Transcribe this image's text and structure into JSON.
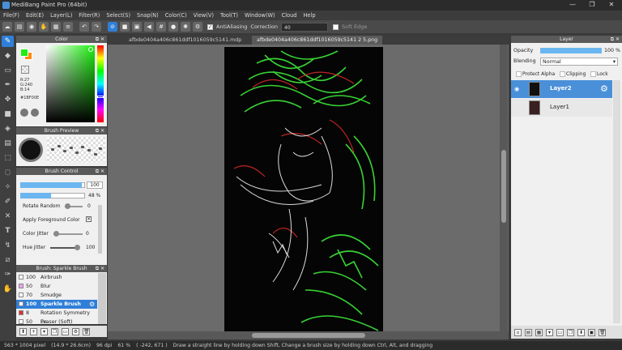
{
  "window": {
    "title": "MediBang Paint Pro (64bit)",
    "minimize": "—",
    "maximize": "❐",
    "close": "✕"
  },
  "menu": [
    "File(F)",
    "Edit(E)",
    "Layer(L)",
    "Filter(R)",
    "Select(S)",
    "Snap(N)",
    "Color(C)",
    "View(V)",
    "Tool(T)",
    "Window(W)",
    "Cloud",
    "Help"
  ],
  "toolbar": {
    "antialiasing_label": "AntiAliasing",
    "antialiasing_checked": true,
    "correction_label": "Correction",
    "correction_value": "40",
    "soft_edge_label": "Soft Edge",
    "soft_edge_checked": false
  },
  "tabs": [
    {
      "label": "afbde0404a406c861ddf1016059c5141.mdp",
      "active": false
    },
    {
      "label": "afbde0404a406c861ddf1016059c5141 2 5.png",
      "active": true
    }
  ],
  "color_panel": {
    "title": "Color",
    "r": "R:27",
    "g": "G:240",
    "b": "B:14",
    "hex": "#1BF00E",
    "foreground": "#1bf00e",
    "background": "#ff8800"
  },
  "brush_preview": {
    "title": "Brush Preview"
  },
  "brush_control": {
    "title": "Brush Control",
    "size_value": "100",
    "size_fraction": 0.95,
    "opacity_value": "48 %",
    "opacity_fraction": 0.48,
    "rotate_random_label": "Rotate Random",
    "rotate_random_value": "0",
    "apply_fg_label": "Apply Foreground Color",
    "color_jitter_label": "Color Jitter",
    "color_jitter_value": "0",
    "hue_jitter_label": "Hue Jitter",
    "hue_jitter_value": "100"
  },
  "brush_list": {
    "title": "Brush: Sparkle Brush",
    "items": [
      {
        "size": "100",
        "name": "Airbrush",
        "color": "#ffffff",
        "selected": false
      },
      {
        "size": "50",
        "name": "Blur",
        "color": "#f0a0f0",
        "selected": false
      },
      {
        "size": "70",
        "name": "Smudge",
        "color": "#ffffff",
        "selected": false
      },
      {
        "size": "100",
        "name": "Sparkle Brush",
        "color": "#ffffff",
        "selected": true
      },
      {
        "size": "8",
        "name": "Rotation Symmetry Pe",
        "color": "#e03030",
        "selected": false
      },
      {
        "size": "50",
        "name": "Eraser (Soft)",
        "color": "#ffffff",
        "selected": false
      }
    ]
  },
  "layer_panel": {
    "title": "Layer",
    "opacity_label": "Opacity",
    "opacity_value": "100 %",
    "opacity_fraction": 1.0,
    "blending_label": "Blending",
    "blending_value": "Normal",
    "protect_alpha_label": "Protect Alpha",
    "clipping_label": "Clipping",
    "lock_label": "Lock",
    "layers": [
      {
        "name": "Layer2",
        "selected": true,
        "visible": true
      },
      {
        "name": "Layer1",
        "selected": false,
        "visible": false
      }
    ]
  },
  "status": {
    "size": "563 * 1004 pixel",
    "physical": "(14.9 * 26.6cm)",
    "dpi": "96 dpi",
    "zoom": "61 %",
    "coords": "( -242, 671 )",
    "hint": "Draw a straight line by holding down Shift, Change a brush size by holding down Ctrl, Alt, and dragging"
  }
}
